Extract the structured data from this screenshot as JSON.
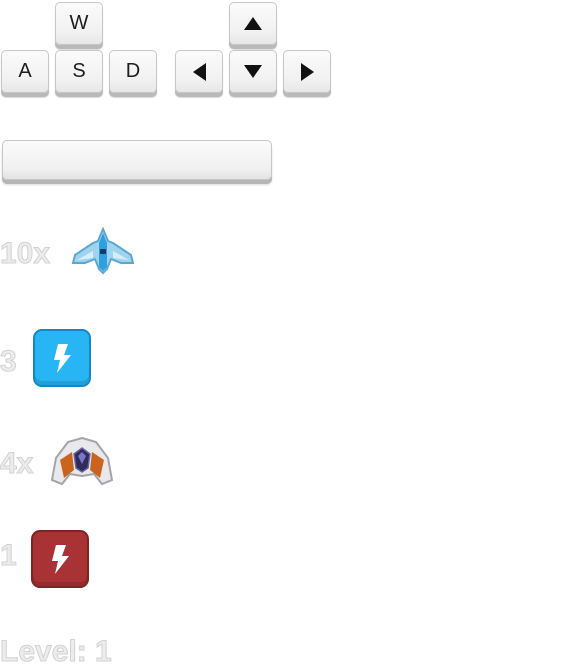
{
  "controls": {
    "wasd": {
      "w": "W",
      "a": "A",
      "s": "S",
      "d": "D"
    },
    "arrows": [
      "up",
      "left",
      "down",
      "right"
    ]
  },
  "hud": {
    "player_lives": {
      "count": "10x",
      "icon": "player-ship-icon"
    },
    "player_powerups": {
      "count": "3",
      "icon": "lightning-bolt-icon",
      "color": "#27b6f3"
    },
    "enemy_lives": {
      "count": "4x",
      "icon": "enemy-ship-icon"
    },
    "enemy_powerups": {
      "count": "1",
      "icon": "lightning-bolt-icon",
      "color": "#a93334"
    },
    "level_text": "Level: 1"
  },
  "bar": {
    "fill_fraction": 0
  }
}
